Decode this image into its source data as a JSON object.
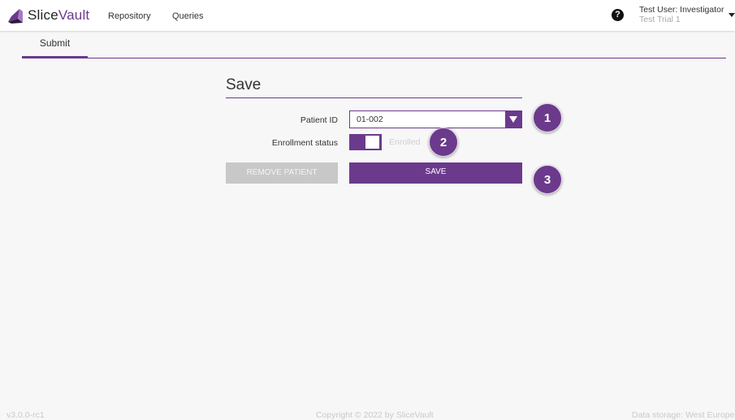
{
  "app": {
    "logo_main": "Slice",
    "logo_accent": "Vault"
  },
  "nav": {
    "repository": "Repository",
    "queries": "Queries"
  },
  "user": {
    "help_symbol": "?",
    "name": "Test User: Investigator",
    "trial": "Test Trial 1"
  },
  "tabs": {
    "submit": "Submit"
  },
  "form": {
    "title": "Save",
    "patient_id_label": "Patient ID",
    "patient_id_value": "01-002",
    "enrollment_label": "Enrollment status",
    "enrollment_value": "Enrolled",
    "remove_button": "REMOVE PATIENT",
    "save_button": "SAVE"
  },
  "callouts": {
    "one": "1",
    "two": "2",
    "three": "3"
  },
  "footer": {
    "version": "v3.0.0-rc1",
    "copyright": "Copyright © 2022 by SliceVault",
    "storage": "Data storage: West Europe"
  },
  "colors": {
    "accent": "#6b3a8c",
    "background": "#f7f7f7"
  },
  "icons": {
    "logo": "slicevault-logo-icon",
    "help": "help-icon",
    "user_menu": "chevron-down-icon",
    "select": "dropdown-arrow-icon"
  }
}
